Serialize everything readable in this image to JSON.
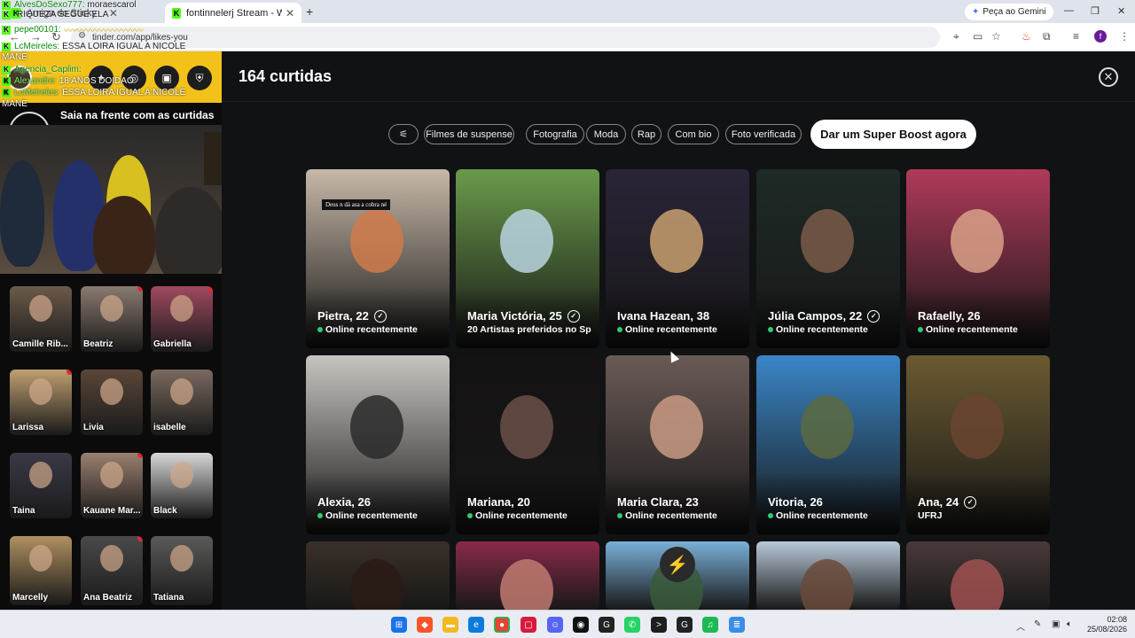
{
  "browser": {
    "tabs": [
      {
        "label": "Amiga do Sticky"
      },
      {
        "label": "fontinnelerj Stream - Watch Liv"
      }
    ],
    "new_tab_icon": "+",
    "gemini_label": "Peça ao Gemini",
    "url": "tinder.com/app/likes-you",
    "profile_initial": "f"
  },
  "chat": {
    "lines": [
      {
        "user": "AlvesDoSexo777:",
        "text": "moraescarol",
        "light": true
      },
      {
        "user": "",
        "text": "RIQUEZA SEGUE ELA",
        "light": false
      },
      {
        "user": "pepe00101:",
        "text": "〰〰〰〰〰〰〰〰〰",
        "light": false
      },
      {
        "user": "LcMeireles:",
        "text": "ESSA LOIRA IGUAL A NICOLE",
        "light": false
      },
      {
        "user": "",
        "text": "MANE",
        "light": true
      },
      {
        "user": "Agencia_Caplim:",
        "text": "",
        "light": false
      },
      {
        "user": "Alexandre:",
        "text": "18 ANOS DOIDAO",
        "light": true
      },
      {
        "user": "LcMeireles:",
        "text": "ESSA LOIRA IGUAL A NICOLE",
        "light": true
      },
      {
        "user": "",
        "text": "MANE",
        "light": true
      }
    ]
  },
  "sidebar": {
    "boost_text": "Saia na frente com as curtidas prioritárias",
    "matches": [
      {
        "name": "Camille Rib...",
        "color": "#6b5a4a",
        "unread": false
      },
      {
        "name": "Beatriz",
        "color": "#8a7a70",
        "unread": true
      },
      {
        "name": "Gabriella",
        "color": "#a04a60",
        "unread": true
      },
      {
        "name": "Larissa",
        "color": "#c0a070",
        "unread": true
      },
      {
        "name": "Livia",
        "color": "#5a4638",
        "unread": false
      },
      {
        "name": "isabelle",
        "color": "#7a6a60",
        "unread": false
      },
      {
        "name": "Taina",
        "color": "#3a3a48",
        "unread": false
      },
      {
        "name": "Kauane Mar...",
        "color": "#9a8070",
        "unread": true
      },
      {
        "name": "Black",
        "color": "#d8d8d8",
        "unread": false
      },
      {
        "name": "Marcelly",
        "color": "#b09060",
        "unread": false
      },
      {
        "name": "Ana Beatriz",
        "color": "#4a4a4a",
        "unread": true
      },
      {
        "name": "Tatiana",
        "color": "#5a5a58",
        "unread": false
      }
    ]
  },
  "main": {
    "title": "164 curtidas",
    "filters": [
      "Filmes de suspense",
      "Fotografia",
      "Moda",
      "Rap",
      "Com bio",
      "Foto verificada"
    ],
    "boost_button": "Dar um Super Boost agora",
    "sticker_text": "Deus n dá asa a cobra né",
    "cards": [
      {
        "name": "Pietra, 22",
        "status": "Online recentemente",
        "verified": true,
        "online": true,
        "bg": "#c7b8a8",
        "face": "#d07a4a"
      },
      {
        "name": "Maria Victória, 25",
        "status": "20 Artistas preferidos no Sp...",
        "verified": true,
        "online": false,
        "bg": "#6a9a4a",
        "face": "#b9d3e0"
      },
      {
        "name": "Ivana Hazean, 38",
        "status": "Online recentemente",
        "verified": false,
        "online": true,
        "bg": "#2a2438",
        "face": "#c9a070"
      },
      {
        "name": "Júlia Campos, 22",
        "status": "Online recentemente",
        "verified": true,
        "online": true,
        "bg": "#1e2a26",
        "face": "#7a5a48"
      },
      {
        "name": "Rafaelly, 26",
        "status": "Online recentemente",
        "verified": false,
        "online": true,
        "bg": "#b03a5a",
        "face": "#d9a088"
      },
      {
        "name": "Alexia, 26",
        "status": "Online recentemente",
        "verified": false,
        "online": true,
        "bg": "#c8c4c0",
        "face": "#2a2a2a"
      },
      {
        "name": "Mariana, 20",
        "status": "Online recentemente",
        "verified": false,
        "online": true,
        "bg": "#141212",
        "face": "#6a5048"
      },
      {
        "name": "Maria Clara, 23",
        "status": "Online recentemente",
        "verified": false,
        "online": true,
        "bg": "#6a5a56",
        "face": "#c99a82"
      },
      {
        "name": "Vitoria, 26",
        "status": "Online recentemente",
        "verified": false,
        "online": true,
        "bg": "#3a86c8",
        "face": "#5a6a40"
      },
      {
        "name": "Ana, 24",
        "status": "UFRJ",
        "verified": true,
        "online": false,
        "bg": "#6a5a30",
        "face": "#6a4430"
      },
      {
        "name": "",
        "status": "",
        "verified": false,
        "online": false,
        "bg": "#3a3028",
        "face": "#2a1a14"
      },
      {
        "name": "",
        "status": "",
        "verified": false,
        "online": false,
        "bg": "#8a2a4a",
        "face": "#c07a70"
      },
      {
        "name": "",
        "status": "",
        "verified": false,
        "online": false,
        "bg": "#7ab0d8",
        "face": "#3a5a3a"
      },
      {
        "name": "",
        "status": "",
        "verified": false,
        "online": false,
        "bg": "#b8c8d8",
        "face": "#6a4a3a"
      },
      {
        "name": "",
        "status": "",
        "verified": false,
        "online": false,
        "bg": "#4a3a3a",
        "face": "#a05050"
      }
    ]
  },
  "taskbar": {
    "time": "02:08",
    "date": "25/08/2026"
  }
}
